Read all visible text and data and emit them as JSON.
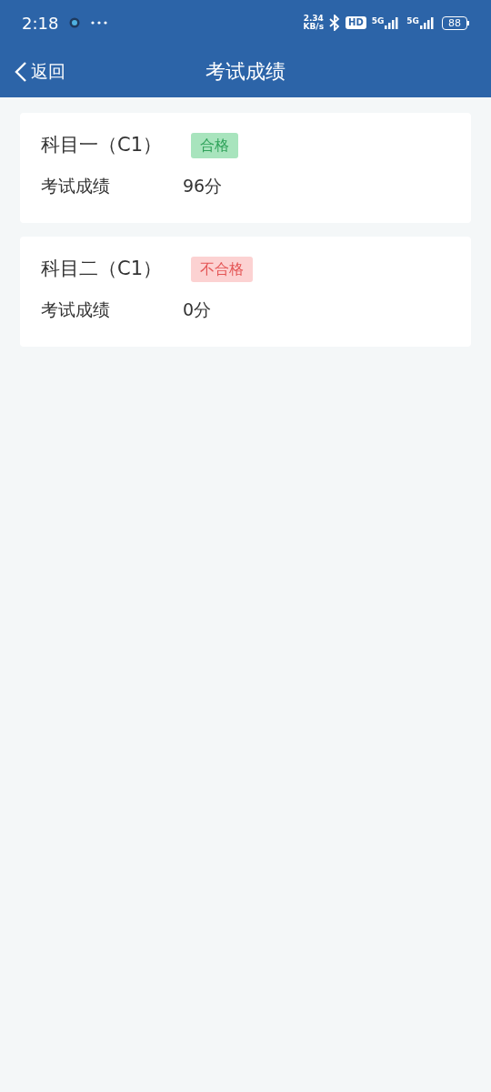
{
  "status_bar": {
    "time": "2:18",
    "speed_value": "2.34",
    "speed_unit": "KB/s",
    "hd": "HD",
    "networks": [
      "5G",
      "5G"
    ],
    "battery": "88"
  },
  "nav": {
    "back": "返回",
    "title": "考试成绩"
  },
  "results": [
    {
      "subject": "科目一（C1）",
      "status": "合格",
      "kind": "pass",
      "label": "考试成绩",
      "score": "96分"
    },
    {
      "subject": "科目二（C1）",
      "status": "不合格",
      "kind": "fail",
      "label": "考试成绩",
      "score": "0分"
    }
  ]
}
